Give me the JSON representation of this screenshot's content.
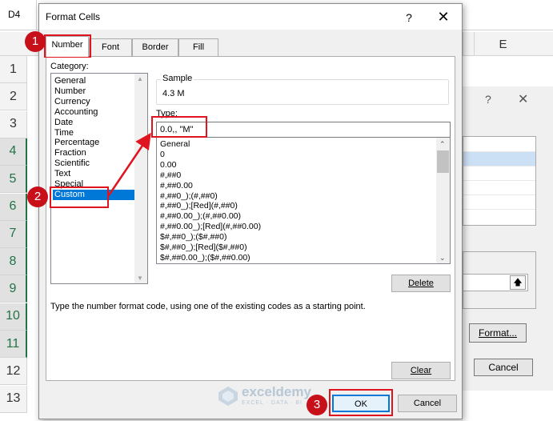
{
  "excel": {
    "name_box": "D4",
    "column_e": "E",
    "rows": [
      "1",
      "2",
      "3",
      "4",
      "5",
      "6",
      "7",
      "8",
      "9",
      "10",
      "11",
      "12",
      "13"
    ]
  },
  "bg_dialog": {
    "help": "?",
    "close": "✕",
    "format_button": "Format...",
    "cancel_button": "Cancel",
    "collapse_icon": "🡅"
  },
  "dialog": {
    "title": "Format Cells",
    "help": "?",
    "close": "✕",
    "tabs": [
      {
        "label": "Number"
      },
      {
        "label": "Font"
      },
      {
        "label": "Border"
      },
      {
        "label": "Fill"
      }
    ],
    "category_label": "Category:",
    "categories": [
      "General",
      "Number",
      "Currency",
      "Accounting",
      "Date",
      "Time",
      "Percentage",
      "Fraction",
      "Scientific",
      "Text",
      "Special",
      "Custom"
    ],
    "selected_category": "Custom",
    "sample_label": "Sample",
    "sample_value": "4.3 M",
    "type_label": "Type:",
    "type_value": "0.0,, \"M\"",
    "type_list": [
      "General",
      "0",
      "0.00",
      "#,##0",
      "#,##0.00",
      "#,##0_);(#,##0)",
      "#,##0_);[Red](#,##0)",
      "#,##0.00_);(#,##0.00)",
      "#,##0.00_);[Red](#,##0.00)",
      "$#,##0_);($#,##0)",
      "$#,##0_);[Red]($#,##0)",
      "$#,##0.00_);($#,##0.00)"
    ],
    "delete_button": "Delete",
    "description": "Type the number format code, using one of the existing codes as a starting point.",
    "clear_button": "Clear",
    "ok_button": "OK",
    "cancel_button": "Cancel"
  },
  "annotations": {
    "step1": "1",
    "step2": "2",
    "step3": "3",
    "color": "#e0141e"
  },
  "watermark": {
    "name": "exceldemy",
    "tagline": "EXCEL · DATA · BI"
  }
}
